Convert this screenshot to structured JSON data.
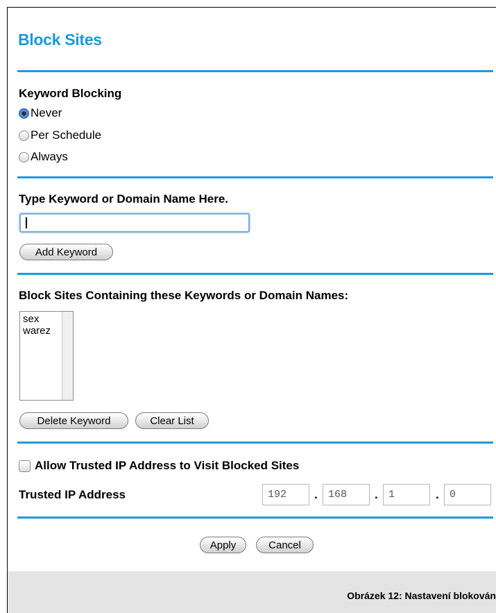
{
  "page": {
    "title": "Block Sites"
  },
  "keyword_blocking": {
    "heading": "Keyword Blocking",
    "options": [
      {
        "label": "Never",
        "checked": true
      },
      {
        "label": "Per Schedule",
        "checked": false
      },
      {
        "label": "Always",
        "checked": false
      }
    ]
  },
  "keyword_entry": {
    "heading": "Type Keyword or Domain Name Here.",
    "value": "",
    "add_button": "Add Keyword"
  },
  "blocked_list": {
    "heading": "Block Sites Containing these Keywords or Domain Names:",
    "items": [
      "sex",
      "warez"
    ],
    "delete_button": "Delete Keyword",
    "clear_button": "Clear List"
  },
  "trusted": {
    "checkbox_label": "Allow Trusted IP Address to Visit Blocked Sites",
    "checked": false,
    "ip_label": "Trusted IP Address",
    "ip_octets": [
      "192",
      "168",
      "1",
      "0"
    ],
    "separator": "."
  },
  "actions": {
    "apply": "Apply",
    "cancel": "Cancel"
  },
  "caption": "Obrázek 12: Nastavení blokován",
  "colors": {
    "accent": "#1e9bd7",
    "footer_bg": "#e4e4e4"
  }
}
